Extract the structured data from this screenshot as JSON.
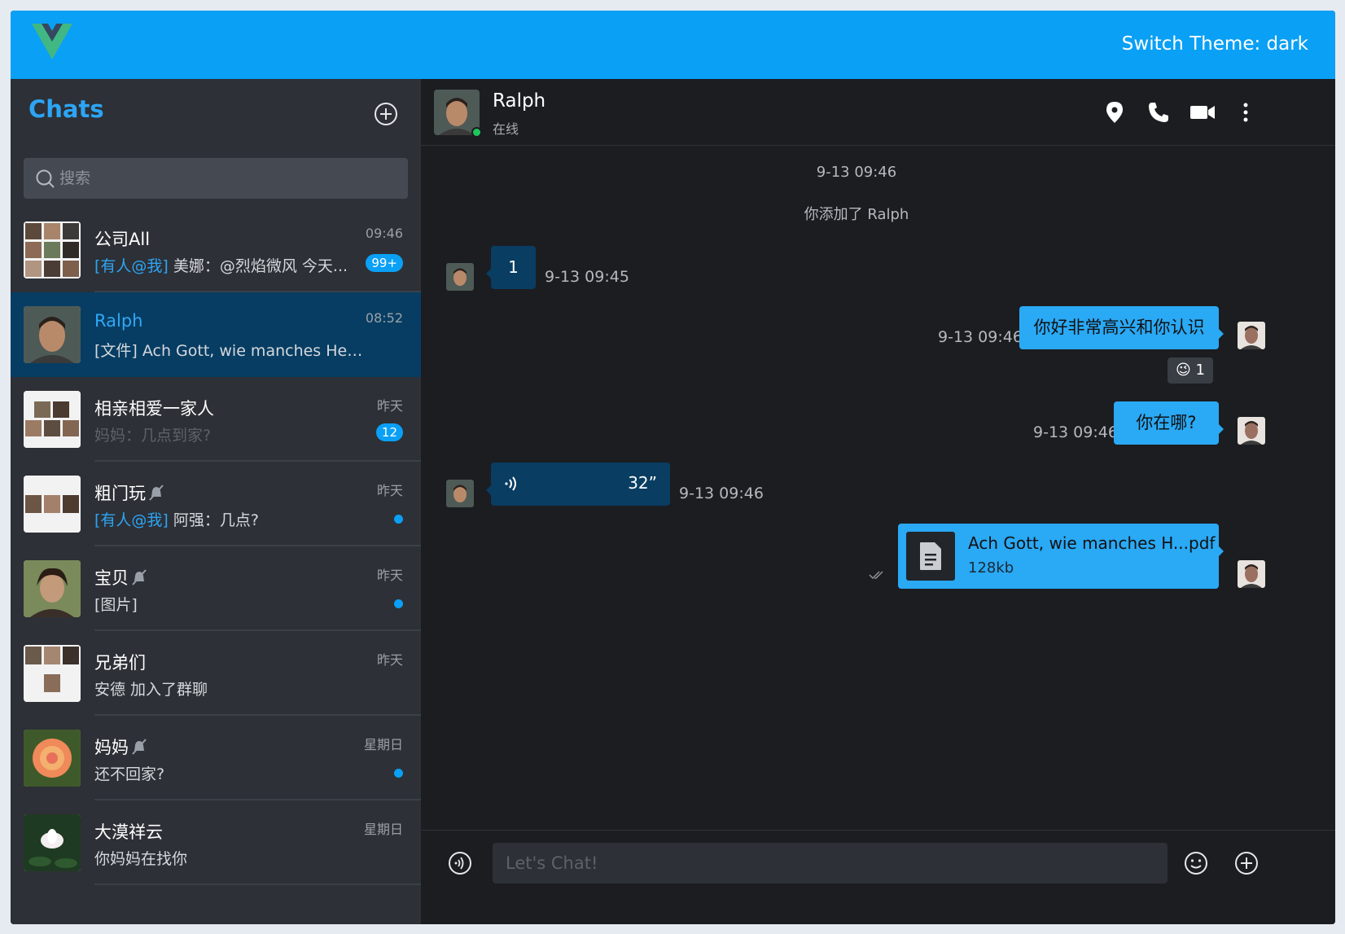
{
  "topbar": {
    "theme_label": "Switch Theme: dark"
  },
  "sidebar": {
    "title": "Chats",
    "search_placeholder": "搜索",
    "chats": [
      {
        "name": "公司All",
        "time": "09:46",
        "mention": "[有人@我]",
        "preview": " 美娜：@烈焰微风 今天...",
        "badge": "99+",
        "muted": false
      },
      {
        "name": "Ralph",
        "time": "08:52",
        "mention": "",
        "preview": "[文件] Ach Gott, wie manches Herz...",
        "badge": "",
        "muted": false,
        "active": true
      },
      {
        "name": "相亲相爱一家人",
        "time": "昨天",
        "mention": "",
        "preview": "妈妈：几点到家?",
        "badge": "12",
        "muted": false
      },
      {
        "name": "粗门玩",
        "time": "昨天",
        "mention": "[有人@我]",
        "preview": " 阿强：几点?",
        "badge": "",
        "muted": true,
        "dot": true
      },
      {
        "name": "宝贝",
        "time": "昨天",
        "mention": "",
        "preview": "[图片]",
        "badge": "",
        "muted": true,
        "dot": true
      },
      {
        "name": "兄弟们",
        "time": "昨天",
        "mention": "",
        "preview": "安德 加入了群聊",
        "badge": "",
        "muted": false
      },
      {
        "name": "妈妈",
        "time": "星期日",
        "mention": "",
        "preview": "还不回家?",
        "badge": "",
        "muted": true,
        "dot": true
      },
      {
        "name": "大漠祥云",
        "time": "星期日",
        "mention": "",
        "preview": "你妈妈在找你",
        "badge": "",
        "muted": false
      }
    ]
  },
  "chat": {
    "contact_name": "Ralph",
    "contact_status": "在线",
    "system_time": "9-13 09:46",
    "system_notice": "你添加了 Ralph",
    "messages": [
      {
        "text": "1",
        "time": "9-13 09:45"
      },
      {
        "text": "你好非常高兴和你认识",
        "time": "9-13 09:46",
        "reaction": "😉",
        "reaction_count": "1"
      },
      {
        "text": "你在哪?",
        "time": "9-13 09:46"
      },
      {
        "voice_duration": "32”",
        "time": "9-13 09:46"
      },
      {
        "file_name": "Ach Gott, wie manches H...pdf",
        "file_size": "128kb"
      }
    ],
    "input_placeholder": "Let's Chat!"
  },
  "colors": {
    "brand": "#0aa0f5",
    "sidebar_bg": "#2d3036",
    "panel_bg": "#1b1d21",
    "active_row": "#073d63"
  }
}
